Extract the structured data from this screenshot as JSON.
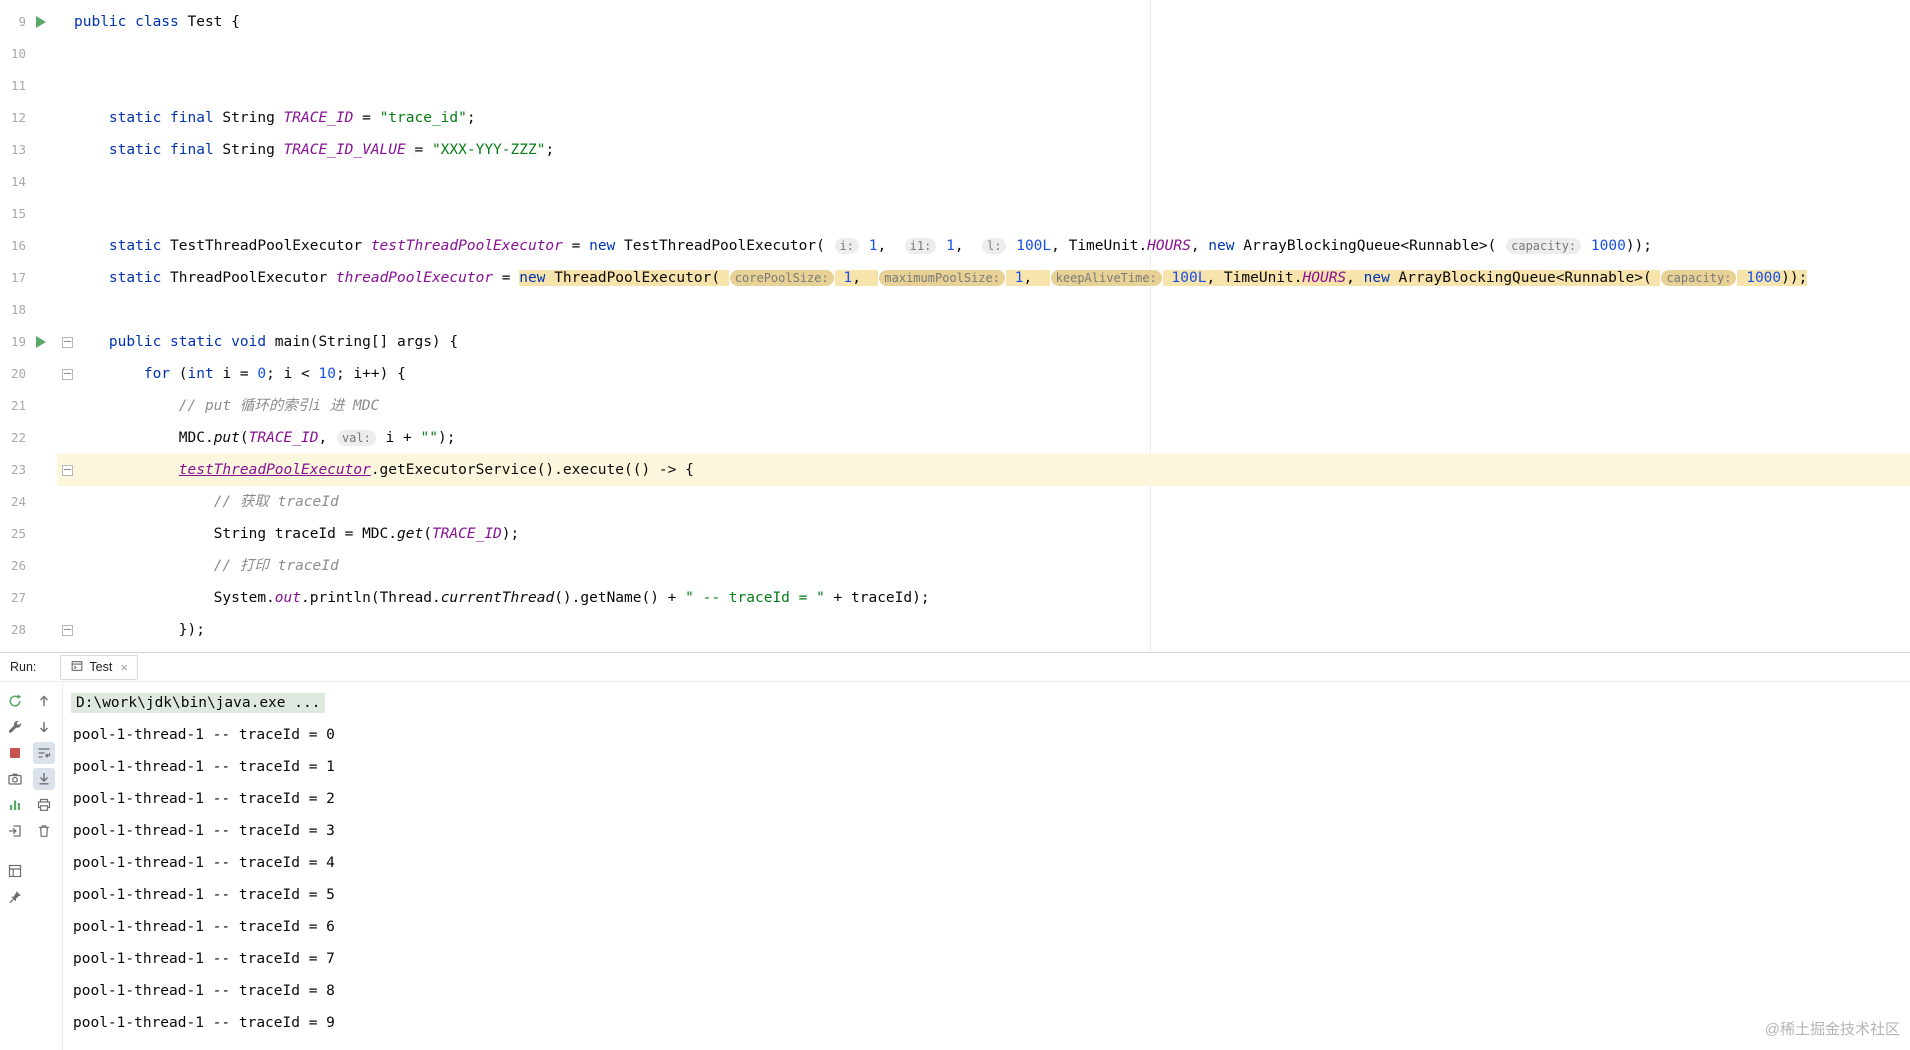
{
  "colors": {
    "kw": "#0033B3",
    "str": "#067D17",
    "num": "#1750EB",
    "cmt": "#8C8C8C",
    "fld": "#871094",
    "hintBg": "#EDEDED",
    "hintMark": "#E8D194",
    "mark": "#F7E3AC",
    "curLine": "#FCF6DD",
    "runGreen": "#59A869",
    "stopRed": "#C75450",
    "lineNum": "#A9A9A9",
    "consoleCmdBg": "#DFE9DF",
    "borderStrong": "#D4D4D4",
    "watermark": "#B5B5B5"
  },
  "editor": {
    "lines": [
      {
        "num": 9,
        "run": true,
        "seg": [
          [
            "k",
            "public class"
          ],
          [
            "p",
            " Test {"
          ]
        ]
      },
      {
        "num": 10,
        "seg": []
      },
      {
        "num": 11,
        "seg": []
      },
      {
        "num": 12,
        "seg": [
          [
            "p",
            "    "
          ],
          [
            "k",
            "static final"
          ],
          [
            "p",
            " String "
          ],
          [
            "f",
            "TRACE_ID"
          ],
          [
            "p",
            " = "
          ],
          [
            "s",
            "\"trace_id\""
          ],
          [
            "p",
            ";"
          ]
        ]
      },
      {
        "num": 13,
        "seg": [
          [
            "p",
            "    "
          ],
          [
            "k",
            "static final"
          ],
          [
            "p",
            " String "
          ],
          [
            "f",
            "TRACE_ID_VALUE"
          ],
          [
            "p",
            " = "
          ],
          [
            "s",
            "\"XXX-YYY-ZZZ\""
          ],
          [
            "p",
            ";"
          ]
        ]
      },
      {
        "num": 14,
        "seg": []
      },
      {
        "num": 15,
        "seg": []
      },
      {
        "num": 16,
        "seg": [
          [
            "p",
            "    "
          ],
          [
            "k",
            "static"
          ],
          [
            "p",
            " TestThreadPoolExecutor "
          ],
          [
            "f",
            "testThreadPoolExecutor"
          ],
          [
            "p",
            " = "
          ],
          [
            "k",
            "new"
          ],
          [
            "p",
            " TestThreadPoolExecutor( "
          ],
          [
            "h",
            "i:"
          ],
          [
            "p",
            " "
          ],
          [
            "n",
            "1"
          ],
          [
            "p",
            ",  "
          ],
          [
            "h",
            "i1:"
          ],
          [
            "p",
            " "
          ],
          [
            "n",
            "1"
          ],
          [
            "p",
            ",  "
          ],
          [
            "h",
            "l:"
          ],
          [
            "p",
            " "
          ],
          [
            "n",
            "100L"
          ],
          [
            "p",
            ", TimeUnit."
          ],
          [
            "e",
            "HOURS"
          ],
          [
            "p",
            ", "
          ],
          [
            "k",
            "new"
          ],
          [
            "p",
            " ArrayBlockingQueue<Runnable>( "
          ],
          [
            "h",
            "capacity:"
          ],
          [
            "p",
            " "
          ],
          [
            "n",
            "1000"
          ],
          [
            "p",
            "));"
          ]
        ]
      },
      {
        "num": 17,
        "seg": [
          [
            "p",
            "    "
          ],
          [
            "k",
            "static"
          ],
          [
            "p",
            " ThreadPoolExecutor "
          ],
          [
            "f",
            "threadPoolExecutor"
          ],
          [
            "p",
            " = "
          ],
          [
            "k",
            "new",
            1
          ],
          [
            "p",
            " ThreadPoolExecutor( ",
            1
          ],
          [
            "h",
            "corePoolSize:",
            1
          ],
          [
            "p",
            " ",
            1
          ],
          [
            "n",
            "1",
            1
          ],
          [
            "p",
            ",  ",
            1
          ],
          [
            "h",
            "maximumPoolSize:",
            1
          ],
          [
            "p",
            " ",
            1
          ],
          [
            "n",
            "1",
            1
          ],
          [
            "p",
            ",  ",
            1
          ],
          [
            "h",
            "keepAliveTime:",
            1
          ],
          [
            "p",
            " ",
            1
          ],
          [
            "n",
            "100L",
            1
          ],
          [
            "p",
            ", TimeUnit.",
            1
          ],
          [
            "e",
            "HOURS",
            1
          ],
          [
            "p",
            ", ",
            1
          ],
          [
            "k",
            "new",
            1
          ],
          [
            "p",
            " ArrayBlockingQueue<Runnable>( ",
            1
          ],
          [
            "h",
            "capacity:",
            1
          ],
          [
            "p",
            " ",
            1
          ],
          [
            "n",
            "1000",
            1
          ],
          [
            "p",
            "));",
            1
          ]
        ]
      },
      {
        "num": 18,
        "seg": []
      },
      {
        "num": 19,
        "run": true,
        "fold": true,
        "seg": [
          [
            "p",
            "    "
          ],
          [
            "k",
            "public static void"
          ],
          [
            "p",
            " main(String[] args) {"
          ]
        ]
      },
      {
        "num": 20,
        "fold": true,
        "seg": [
          [
            "p",
            "        "
          ],
          [
            "k",
            "for"
          ],
          [
            "p",
            " ("
          ],
          [
            "k",
            "int"
          ],
          [
            "p",
            " i = "
          ],
          [
            "n",
            "0"
          ],
          [
            "p",
            "; i < "
          ],
          [
            "n",
            "10"
          ],
          [
            "p",
            "; i++) {"
          ]
        ]
      },
      {
        "num": 21,
        "seg": [
          [
            "p",
            "            "
          ],
          [
            "c",
            "// put 循环的索引i 进 MDC"
          ]
        ]
      },
      {
        "num": 22,
        "seg": [
          [
            "p",
            "            MDC."
          ],
          [
            "sm",
            "put"
          ],
          [
            "p",
            "("
          ],
          [
            "f",
            "TRACE_ID"
          ],
          [
            "p",
            ", "
          ],
          [
            "h",
            "val:"
          ],
          [
            "p",
            " i + "
          ],
          [
            "s",
            "\"\""
          ],
          [
            "p",
            ");"
          ]
        ]
      },
      {
        "num": 23,
        "cur": true,
        "fold": true,
        "seg": [
          [
            "p",
            "            "
          ],
          [
            "fu",
            "testThreadPoolExecutor"
          ],
          [
            "p",
            ".getExecutorService().execute(() -> {"
          ]
        ]
      },
      {
        "num": 24,
        "seg": [
          [
            "p",
            "                "
          ],
          [
            "c",
            "// 获取 traceId"
          ]
        ]
      },
      {
        "num": 25,
        "seg": [
          [
            "p",
            "                String traceId = MDC."
          ],
          [
            "sm",
            "get"
          ],
          [
            "p",
            "("
          ],
          [
            "f",
            "TRACE_ID"
          ],
          [
            "p",
            ");"
          ]
        ]
      },
      {
        "num": 26,
        "seg": [
          [
            "p",
            "                "
          ],
          [
            "c",
            "// 打印 traceId"
          ]
        ]
      },
      {
        "num": 27,
        "seg": [
          [
            "p",
            "                System."
          ],
          [
            "f",
            "out"
          ],
          [
            "p",
            ".println(Thread."
          ],
          [
            "sm",
            "currentThread"
          ],
          [
            "p",
            "().getName() + "
          ],
          [
            "s",
            "\" -- traceId = \""
          ],
          [
            "p",
            " + traceId);"
          ]
        ]
      },
      {
        "num": 28,
        "fold": true,
        "seg": [
          [
            "p",
            "            });"
          ]
        ]
      }
    ]
  },
  "run_panel": {
    "label": "Run:",
    "tab": {
      "title": "Test",
      "close_glyph": "×"
    },
    "toolbar": {
      "col1": [
        {
          "name": "rerun-icon"
        },
        {
          "name": "wrench-icon"
        },
        {
          "name": "stop-icon"
        },
        {
          "name": "camera-icon"
        },
        {
          "name": "profiler-icon"
        },
        {
          "name": "exit-icon"
        },
        {
          "name": "layout-icon"
        },
        {
          "name": "pin-icon"
        }
      ],
      "col2": [
        {
          "name": "up-arrow-icon"
        },
        {
          "name": "down-arrow-icon"
        },
        {
          "name": "soft-wrap-icon",
          "active": true
        },
        {
          "name": "scroll-end-icon",
          "active": true
        },
        {
          "name": "print-icon"
        },
        {
          "name": "clear-icon"
        }
      ]
    },
    "console": [
      "D:\\work\\jdk\\bin\\java.exe ...",
      "pool-1-thread-1 -- traceId = 0",
      "pool-1-thread-1 -- traceId = 1",
      "pool-1-thread-1 -- traceId = 2",
      "pool-1-thread-1 -- traceId = 3",
      "pool-1-thread-1 -- traceId = 4",
      "pool-1-thread-1 -- traceId = 5",
      "pool-1-thread-1 -- traceId = 6",
      "pool-1-thread-1 -- traceId = 7",
      "pool-1-thread-1 -- traceId = 8",
      "pool-1-thread-1 -- traceId = 9"
    ]
  },
  "watermark": "@稀土掘金技术社区"
}
